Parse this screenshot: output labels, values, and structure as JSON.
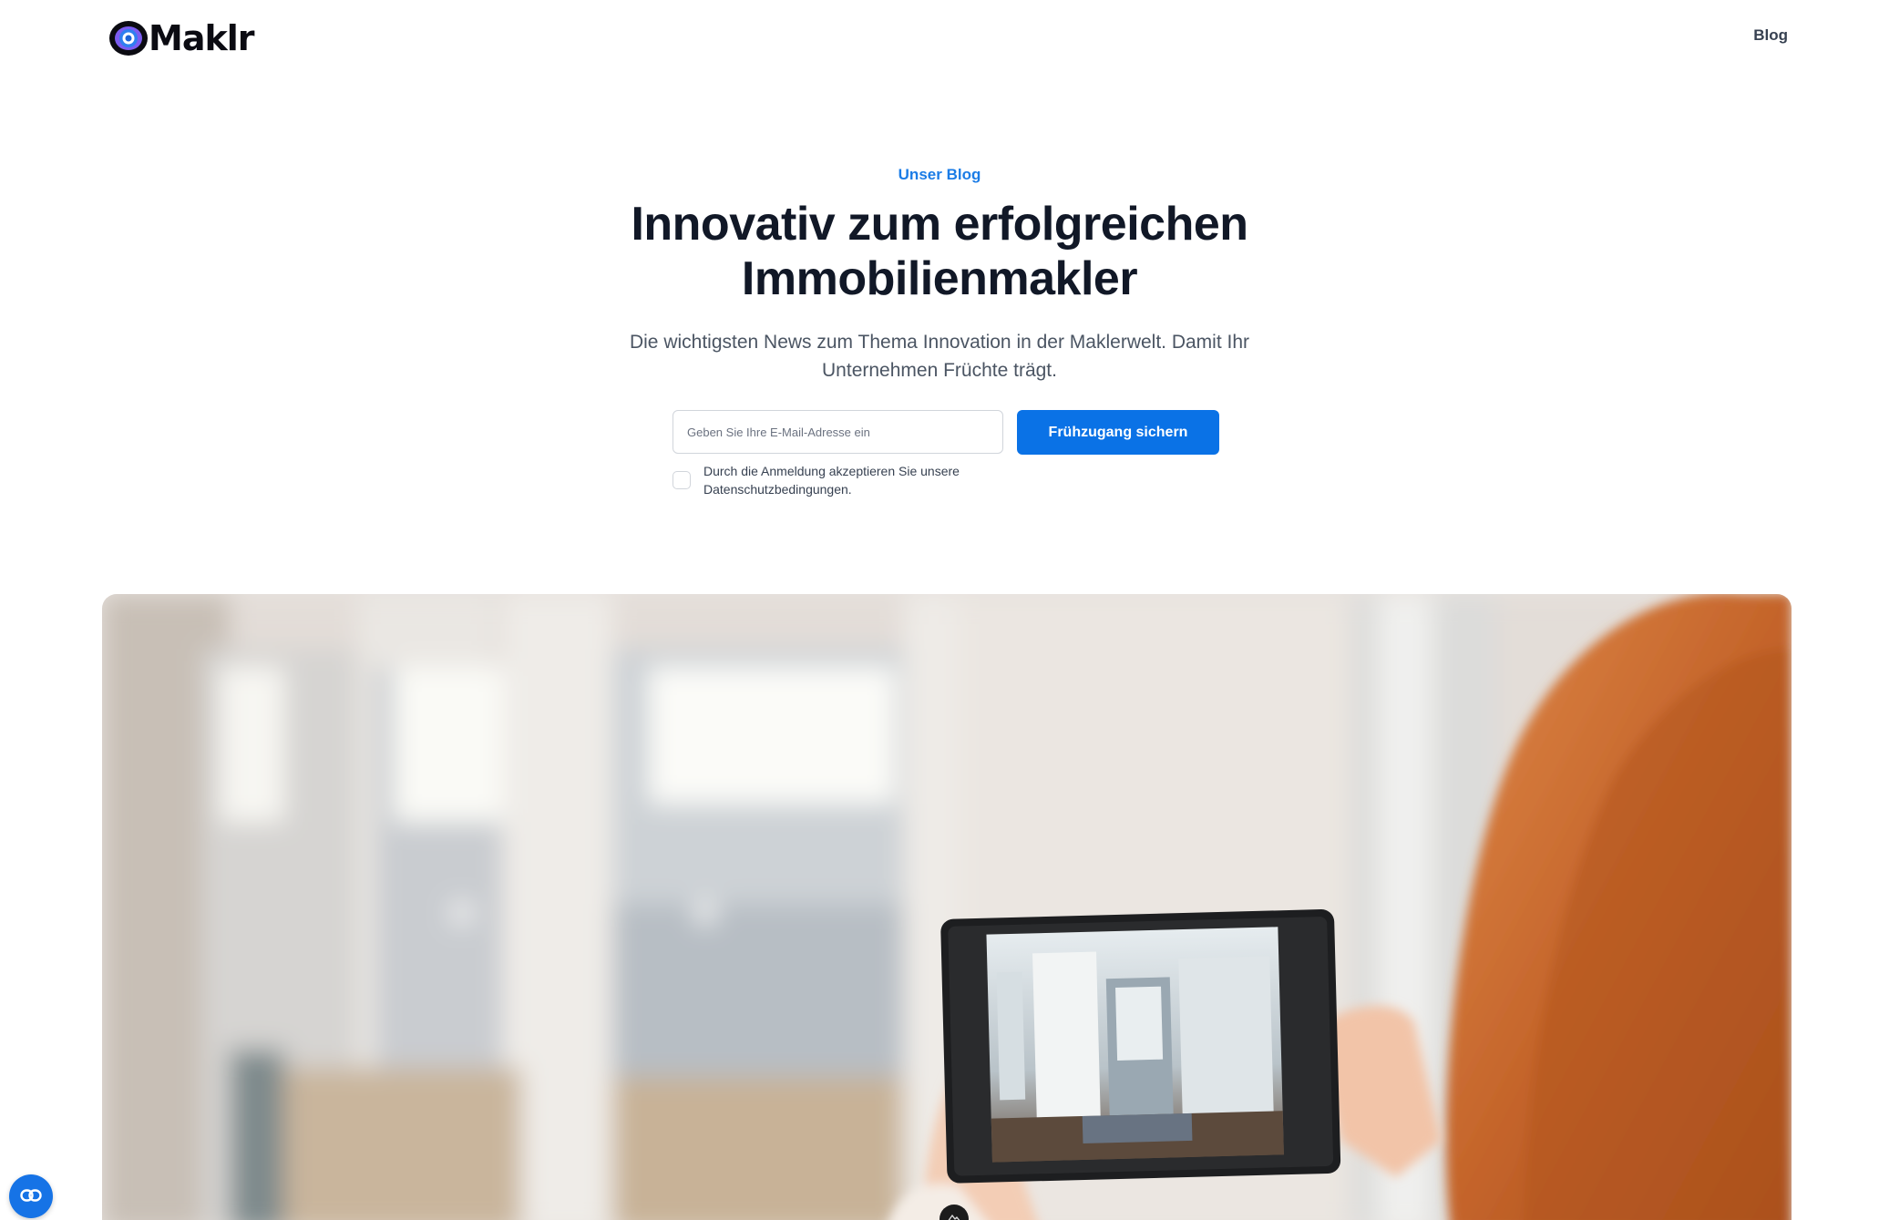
{
  "header": {
    "logo_text": "Maklr",
    "nav_blog": "Blog"
  },
  "hero": {
    "eyebrow": "Unser Blog",
    "headline": "Innovativ zum erfolgreichen Immobilienmakler",
    "subtext": "Die wichtigsten News zum Thema Innovation in der Maklerwelt. Damit Ihr Unternehmen Früchte trägt."
  },
  "signup": {
    "email_placeholder": "Geben Sie Ihre E-Mail-Adresse ein",
    "email_value": "",
    "cta_label": "Frühzugang sichern",
    "consent_text": "Durch die Anmeldung akzeptieren Sie unsere Datenschutzbedingungen.",
    "consent_checked": false
  },
  "colors": {
    "accent": "#0a72e6",
    "eyebrow": "#1b7ce6",
    "heading": "#111827",
    "body_text": "#4b5563"
  },
  "icons": {
    "logo": "eye-logo-icon",
    "fab": "link-icon",
    "badge": "mountain-icon"
  }
}
